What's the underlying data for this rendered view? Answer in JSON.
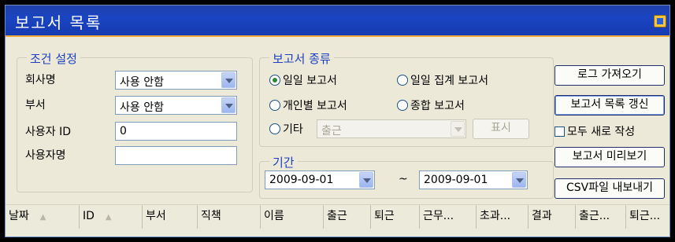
{
  "window": {
    "title": "보고서 목록",
    "icon": "app-icon"
  },
  "conditions": {
    "legend": "조건 설정",
    "company_label": "회사명",
    "company_value": "사용 안함",
    "dept_label": "부서",
    "dept_value": "사용 안함",
    "userid_label": "사용자 ID",
    "userid_value": "0",
    "username_label": "사용자명",
    "username_value": ""
  },
  "report_type": {
    "legend": "보고서 종류",
    "options": [
      {
        "label": "일일 보고서",
        "selected": true
      },
      {
        "label": "일일 집계 보고서",
        "selected": false
      },
      {
        "label": "개인별 보고서",
        "selected": false
      },
      {
        "label": "종합 보고서",
        "selected": false
      },
      {
        "label": "기타",
        "selected": false
      }
    ],
    "other_select_value": "출근",
    "display_button": "표시"
  },
  "period": {
    "legend": "기간",
    "from": "2009-09-01",
    "separator": "~",
    "to": "2009-09-01"
  },
  "actions": {
    "import_log": "로그 가져오기",
    "refresh_list": "보고서 목록 갱신",
    "recreate_all": "모두 새로 작성",
    "preview": "보고서 미리보기",
    "export_csv": "CSV파일 내보내기"
  },
  "grid": {
    "columns": [
      "날짜",
      "ID",
      "부서",
      "직책",
      "이름",
      "출근",
      "퇴근",
      "근무...",
      "초과...",
      "결과",
      "출근...",
      "퇴근..."
    ],
    "sort_glyph": "▲"
  }
}
